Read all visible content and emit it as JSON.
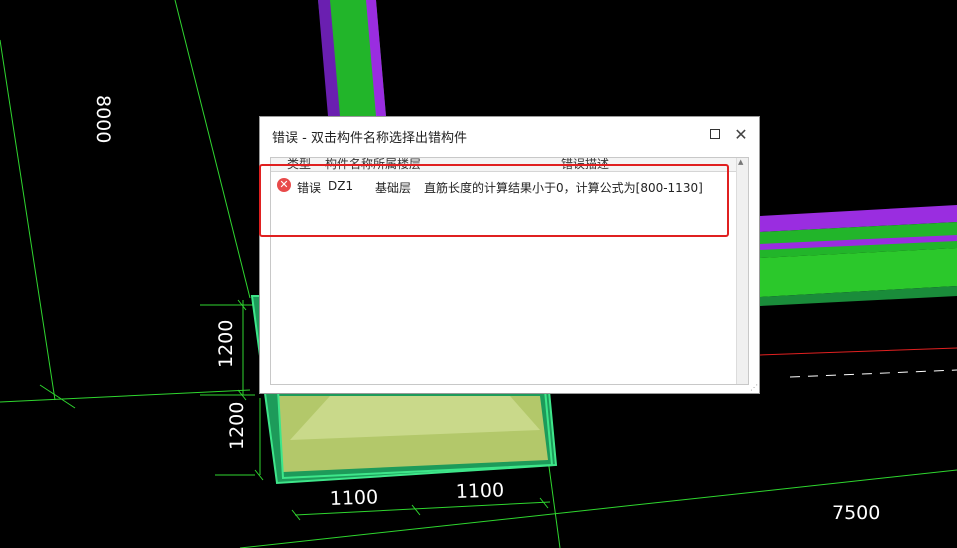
{
  "cad": {
    "dim_8000": "8000",
    "dim_1200_upper": "1200",
    "dim_1200_lower": "1200",
    "dim_1100_left": "1100",
    "dim_1100_right": "1100",
    "dim_7500": "7500"
  },
  "dialog": {
    "title": "错误 - 双击构件名称选择出错构件",
    "columns": [
      "类型",
      "构件名称",
      "所属楼层",
      "错误描述"
    ],
    "rows": [
      {
        "type": "错误",
        "component": "DZ1",
        "floor": "基础层",
        "description": "直筋长度的计算结果小于0，计算公式为[800-1130]"
      }
    ]
  },
  "colors": {
    "beam_green": "#22b52a",
    "beam_purple": "#9a2de0",
    "footing_olive": "#b3c86a",
    "dimension_green": "#3ee63e",
    "highlight_red": "#e02020",
    "error_icon": "#e84a4a"
  },
  "icons": {
    "maximize": "maximize-icon",
    "close": "close-icon",
    "error": "error-circle-icon"
  }
}
